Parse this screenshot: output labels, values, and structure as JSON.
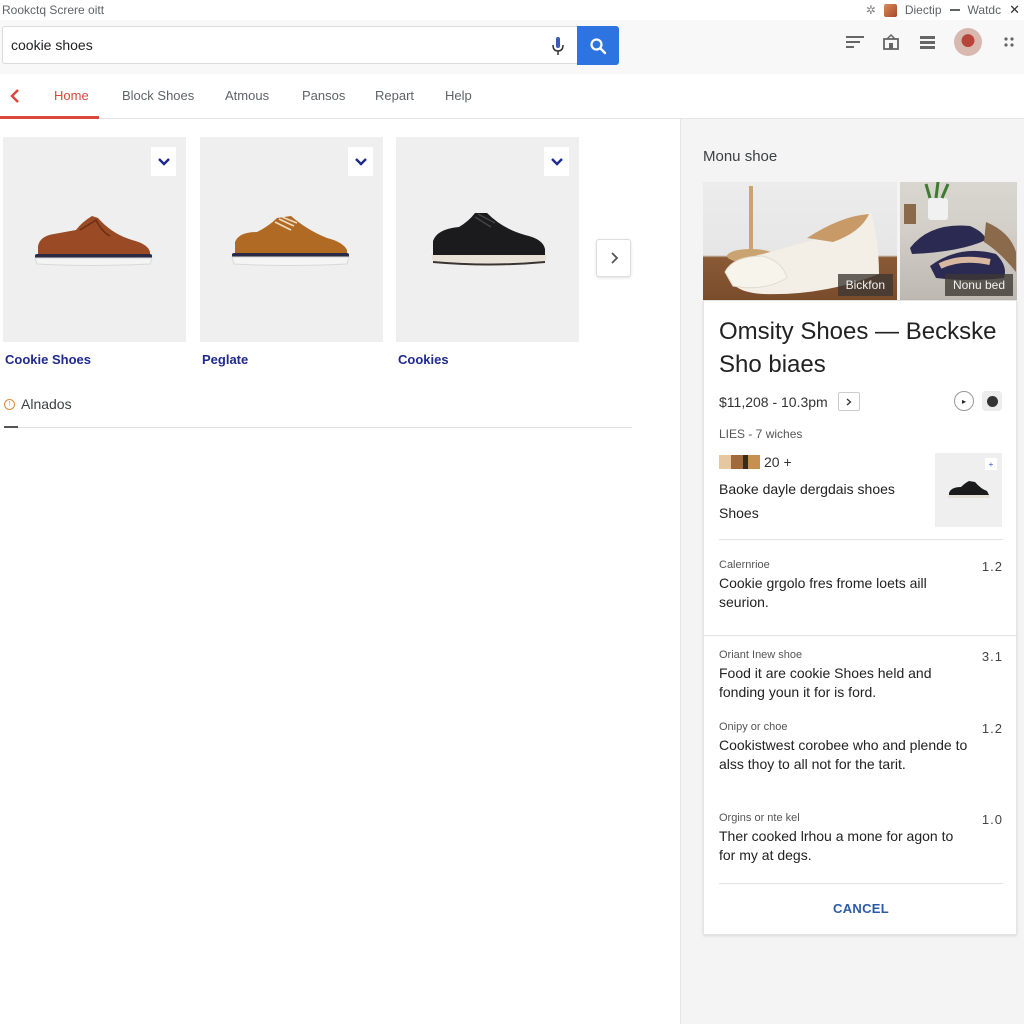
{
  "window": {
    "title": "Rookctq Screre oitt",
    "controls": {
      "tab_label": "Diectip",
      "right_label": "Watdc"
    }
  },
  "search": {
    "value": "cookie shoes",
    "placeholder": "",
    "button_label": "Search"
  },
  "header_icons": [
    "filter-icon",
    "store-icon",
    "menu-icon",
    "avatar",
    "apps-icon"
  ],
  "nav": {
    "back_label": "Back",
    "tabs": [
      {
        "label": "Home",
        "active": true
      },
      {
        "label": "Block Shoes",
        "active": false
      },
      {
        "label": "Atmous",
        "active": false
      },
      {
        "label": "Pansos",
        "active": false
      },
      {
        "label": "Repart",
        "active": false
      },
      {
        "label": "Help",
        "active": false
      }
    ],
    "accent_color": "#d9473d"
  },
  "products": [
    {
      "label": "Cookie Shoes",
      "shoe_color": "brown-slip-on"
    },
    {
      "label": "Peglate",
      "shoe_color": "tan-lace-up"
    },
    {
      "label": "Cookies",
      "shoe_color": "black-sneaker"
    }
  ],
  "section": {
    "title": "Alnados"
  },
  "panel": {
    "title": "Monu shoe",
    "gallery": [
      {
        "caption": "Bickfon"
      },
      {
        "caption": "Nonu bed"
      }
    ],
    "knowledge": {
      "title": "Omsity Shoes — Beckske Sho biaes",
      "price": "$11,208 - 10.3pm",
      "meta": "LIES - 7 wiches",
      "thumbs_count": "20 +",
      "description": "Baoke dayle dergdais shoes Shoes",
      "reviews": [
        {
          "source": "Calernrioe",
          "rating": "1.2",
          "text": "Cookie grgolo fres frome loets aill seurion."
        },
        {
          "source": "Oriant Inew shoe",
          "rating": "3.1",
          "text": "Food it are cookie Shoes held and fonding youn it for is ford."
        },
        {
          "source": "Onipy or choe",
          "rating": "1.2",
          "text": "Cookistwest corobee who and plende to alss thoy to all not for the tarit."
        },
        {
          "source": "Orgins or nte kel",
          "rating": "1.0",
          "text": "Ther cooked lrhou a mone for agon to for my at degs."
        }
      ],
      "cancel_label": "CANCEL"
    }
  },
  "colors": {
    "search_button": "#2e74e0",
    "product_link": "#1f2a8c",
    "cancel": "#2b5aa8"
  }
}
